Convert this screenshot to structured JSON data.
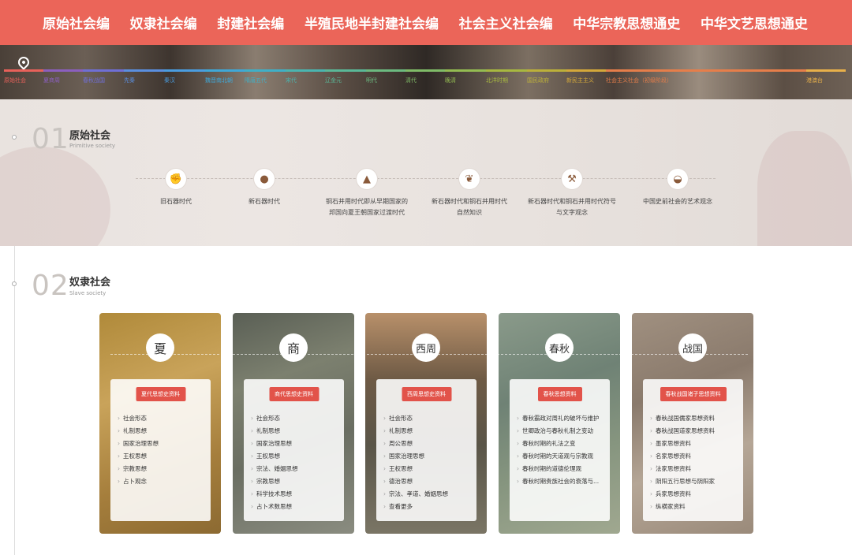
{
  "topnav": [
    "原始社会编",
    "奴隶社会编",
    "封建社会编",
    "半殖民地半封建社会编",
    "社会主义社会编",
    "中华宗教思想通史",
    "中华文艺思想通史"
  ],
  "timeline": {
    "pin_icon": "location-pin-icon",
    "items": [
      {
        "label": "原始社会",
        "color": "#e8615a"
      },
      {
        "label": "夏商周",
        "color": "#8b5fbf"
      },
      {
        "label": "春秋战国",
        "color": "#6f6fd6"
      },
      {
        "label": "先秦",
        "color": "#5a8fe0"
      },
      {
        "label": "秦汉",
        "color": "#4a9de0"
      },
      {
        "label": "魏晋南北朝",
        "color": "#3fa8d8"
      },
      {
        "label": "隋唐五代",
        "color": "#3fb0c8"
      },
      {
        "label": "宋代",
        "color": "#4ab5b0"
      },
      {
        "label": "辽金元",
        "color": "#5ab898"
      },
      {
        "label": "明代",
        "color": "#6cba80"
      },
      {
        "label": "清代",
        "color": "#80bc68"
      },
      {
        "label": "晚清",
        "color": "#94bc52"
      },
      {
        "label": "北洋时期",
        "color": "#a8b840"
      },
      {
        "label": "国民政府",
        "color": "#bcb03a"
      },
      {
        "label": "新民主主义",
        "color": "#d4a83a"
      },
      {
        "label": "社会主义社会（初级阶段）",
        "color": "#e67e4a"
      },
      {
        "label": "港澳台",
        "color": "#e8b04a"
      }
    ]
  },
  "section1": {
    "number": "01",
    "title": "原始社会",
    "subtitle": "Primitive society",
    "eras": [
      {
        "icon": "stone-tool-icon",
        "glyph": "✊",
        "label": "旧石器时代"
      },
      {
        "icon": "polished-stone-icon",
        "glyph": "●",
        "label": "新石器时代"
      },
      {
        "icon": "tent-icon",
        "glyph": "▲",
        "label": "铜石并用时代即从早期国家的\n邦国向夏王朝国家过渡时代"
      },
      {
        "icon": "grain-icon",
        "glyph": "❦",
        "label": "新石器时代和铜石并用时代\n自然知识"
      },
      {
        "icon": "axe-icon",
        "glyph": "⚒",
        "label": "新石器时代和铜石并用时代符号\n与文字观念"
      },
      {
        "icon": "pottery-bowl-icon",
        "glyph": "◒",
        "label": "中国史前社会的艺术观念"
      }
    ]
  },
  "section2": {
    "number": "02",
    "title": "奴隶社会",
    "subtitle": "Slave society",
    "cards": [
      {
        "char": "夏",
        "button": "夏代思想史资料",
        "bg": "linear-gradient(160deg,#b08a3a,#c9a35a 35%,#a57e3c 70%,#8c6a32)",
        "items": [
          "社会形态",
          "礼制思想",
          "国家治理思想",
          "王权思想",
          "宗教思想",
          "占卜观念"
        ],
        "more": ""
      },
      {
        "char": "商",
        "button": "商代思想史资料",
        "bg": "linear-gradient(160deg,#5a5f55,#7c806f 30%,#6a6e62 60%,#8a8c80)",
        "items": [
          "社会形态",
          "礼制思想",
          "国家治理思想",
          "王权思想",
          "宗法、婚姻思想",
          "宗教思想",
          "科学技术思想",
          "占卜术数思想"
        ],
        "more": ""
      },
      {
        "char": "西周",
        "button": "西周思想史资料",
        "bg": "linear-gradient(180deg,#b8906a,#6e5a45 30%,#5a5548 60%,#7a7565)",
        "items": [
          "社会形态",
          "礼制思想",
          "周公思想",
          "国家治理思想",
          "王权思想",
          "德治思想",
          "宗法、孝道、婚姻思想"
        ],
        "more": "查看更多"
      },
      {
        "char": "春秋",
        "button": "春秋思想资料",
        "bg": "linear-gradient(160deg,#8a9a8a,#6f8275 35%,#86957f 65%,#a0a890)",
        "items": [
          "春秋霸政对周礼的破坏与维护",
          "世卿政治与春秋礼制之变动",
          "春秋时期的礼法之变",
          "春秋时期的天道观与宗教观",
          "春秋时期的道德伦理观",
          "春秋时期贵族社会的衰落与..."
        ],
        "more": ""
      },
      {
        "char": "战国",
        "button": "春秋战国诸子思想资料",
        "bg": "linear-gradient(160deg,#a09080,#8a7a6c 35%,#b5a696 65%,#9a8a7a)",
        "items": [
          "春秋战国儒家思想资料",
          "春秋战国道家思想资料",
          "墨家思想资料",
          "名家思想资料",
          "法家思想资料",
          "阴阳五行思想与阴阳家",
          "兵家思想资料",
          "纵横家资料"
        ],
        "more": ""
      }
    ]
  }
}
